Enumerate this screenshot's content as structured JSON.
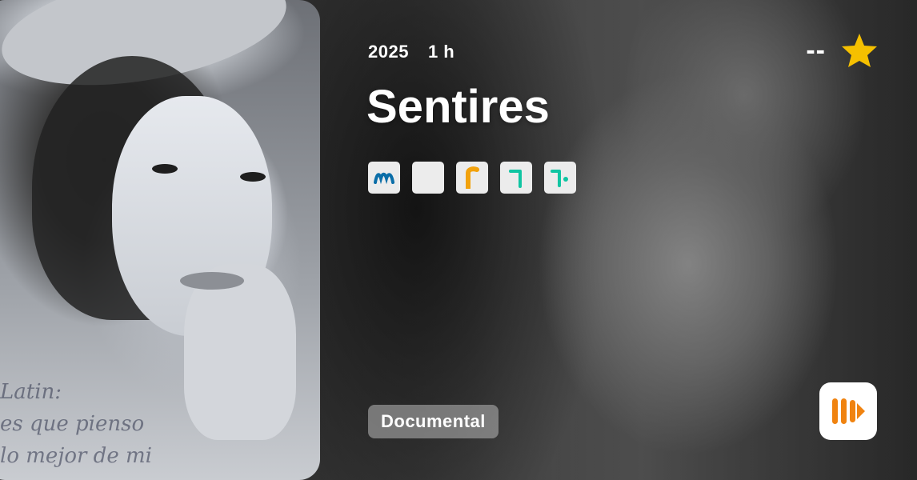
{
  "meta": {
    "year": "2025",
    "duration": "1 h"
  },
  "title": "Sentires",
  "providers": [
    {
      "name": "movistar",
      "glyph": "M",
      "color": "#0b6ea8"
    },
    {
      "name": "blank",
      "glyph": "",
      "color": "#e9e9e9"
    },
    {
      "name": "rakuten-r",
      "glyph": "r",
      "color": "#f2a20c"
    },
    {
      "name": "filmin-1",
      "glyph": "⌐",
      "color": "#10c5a2"
    },
    {
      "name": "filmin-2",
      "glyph": "⌐",
      "color": "#10c5a2"
    }
  ],
  "rating": {
    "score": "--",
    "star_color": "#f5c000"
  },
  "genre": "Documental",
  "poster_script": "Latin:\nes que pienso\nlo mejor de mi",
  "brand": {
    "icon": "play-stripes-icon",
    "color": "#f08310"
  }
}
